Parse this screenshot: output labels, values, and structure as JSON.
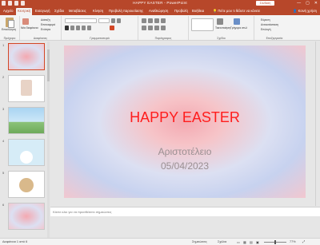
{
  "titlebar": {
    "title": "HAPPY EASTER - PowerPoint",
    "signin": "Σύνδεση",
    "controls": [
      "—",
      "▢",
      "✕"
    ]
  },
  "tabs": {
    "items": [
      "Αρχείο",
      "Κεντρική",
      "Εισαγωγή",
      "Σχέδιο",
      "Μεταβάσεις",
      "Κίνηση",
      "Προβολή παρουσίασης",
      "Αναθεώρηση",
      "Προβολή",
      "Βοήθεια"
    ],
    "active_index": 1,
    "tell_me": "Πείτε μου τι θέλετε να κάνετε",
    "share": "Κοινή χρήση"
  },
  "ribbon": {
    "paste": "Επικόλληση",
    "clipboard": "Πρόχειρο",
    "new_slide": "Νέα διαφάνεια",
    "layout": "Διάταξη",
    "reset": "Επαναφορά",
    "section": "Ενότητα",
    "slides_group": "Διαφάνειες",
    "font_group": "Γραμματοσειρά",
    "paragraph_group": "Παράγραφος",
    "arrange": "Τακτοποίηση",
    "quick_styles": "Γρήγορα στυλ",
    "drawing_group": "Σχέδιο",
    "find": "Εύρεση",
    "replace": "Αντικατάσταση",
    "select": "Επιλογή",
    "editing_group": "Επεξεργασία"
  },
  "thumbnails": {
    "numbers": [
      "1",
      "2",
      "3",
      "4",
      "5",
      "6"
    ]
  },
  "slide": {
    "title": "HAPPY EASTER",
    "subtitle_line1": "Αριστοτέλειο",
    "subtitle_line2": "05/04/2023"
  },
  "notes": {
    "placeholder": "Κάντε κλικ για να προσθέσετε σημειώσεις"
  },
  "statusbar": {
    "slide_info": "Διαφάνεια 1 από 6",
    "notes": "Σημειώσεις",
    "comments": "Σχόλια",
    "zoom_percent": 77,
    "fit_label": "Σας ευχαριστούμε για τη συνεισφορά"
  },
  "colors": {
    "accent": "#b7472a",
    "slide_title": "#ff1d1d",
    "slide_subtitle": "#9a8f92"
  }
}
